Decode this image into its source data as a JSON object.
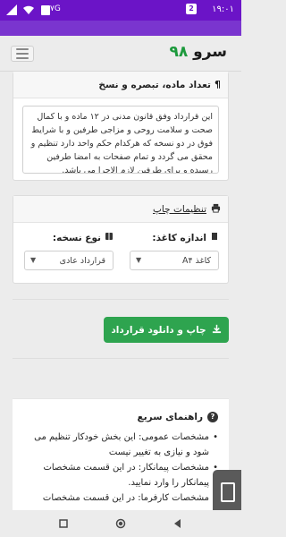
{
  "status_bar": {
    "time": "۱۹:۰۱",
    "network_tag": "‏۷G",
    "notification_badge": "2"
  },
  "header": {
    "brand_part1": "سرو",
    "brand_part2": "۹۸"
  },
  "articles_section": {
    "title": "تعداد ماده، تبصره و نسخ",
    "textarea_value": "این قرارداد وفق قانون مدنی  در ۱۲ ماده  و با کمال صحت و سلامت روحی و مزاجی طرفین و با شرایط فوق در دو نسخه که هرکدام حکم واحد دارد تنظیم و محقق می گردد و تمام صفحات به امضا طرفین رسیده و برای طرفین لازم الاجرا می باشد."
  },
  "print_settings": {
    "title": "تنظیمات چاپ",
    "paper_size_label": "اندازه کاغذ:",
    "paper_size_value": "کاغذ A۴",
    "copy_type_label": "نوع نسخه:",
    "copy_type_value": "قرارداد عادی"
  },
  "actions": {
    "print_download_label": "چاپ و دانلود قرارداد"
  },
  "quick_guide": {
    "title": "راهنمای سریع",
    "items": [
      "مشخصات عمومی: این بخش خودکار تنظیم می شود و نیازی به تغییر نیست",
      "مشخصات پیمانکار: در این قسمت مشخصات پیمانکار را وارد نمایید.",
      "مشخصات کارفرما: در این قسمت مشخصات"
    ]
  },
  "icons": {
    "wifi": "wifi-icon",
    "signal": "signal-icon",
    "battery": "battery-icon",
    "printer": "printer-icon",
    "download": "download-icon",
    "question": "question-circle-icon"
  },
  "colors": {
    "status_bar": "#6b14c7",
    "brand_green": "#1d9a3d",
    "button_green": "#2ea44f"
  }
}
